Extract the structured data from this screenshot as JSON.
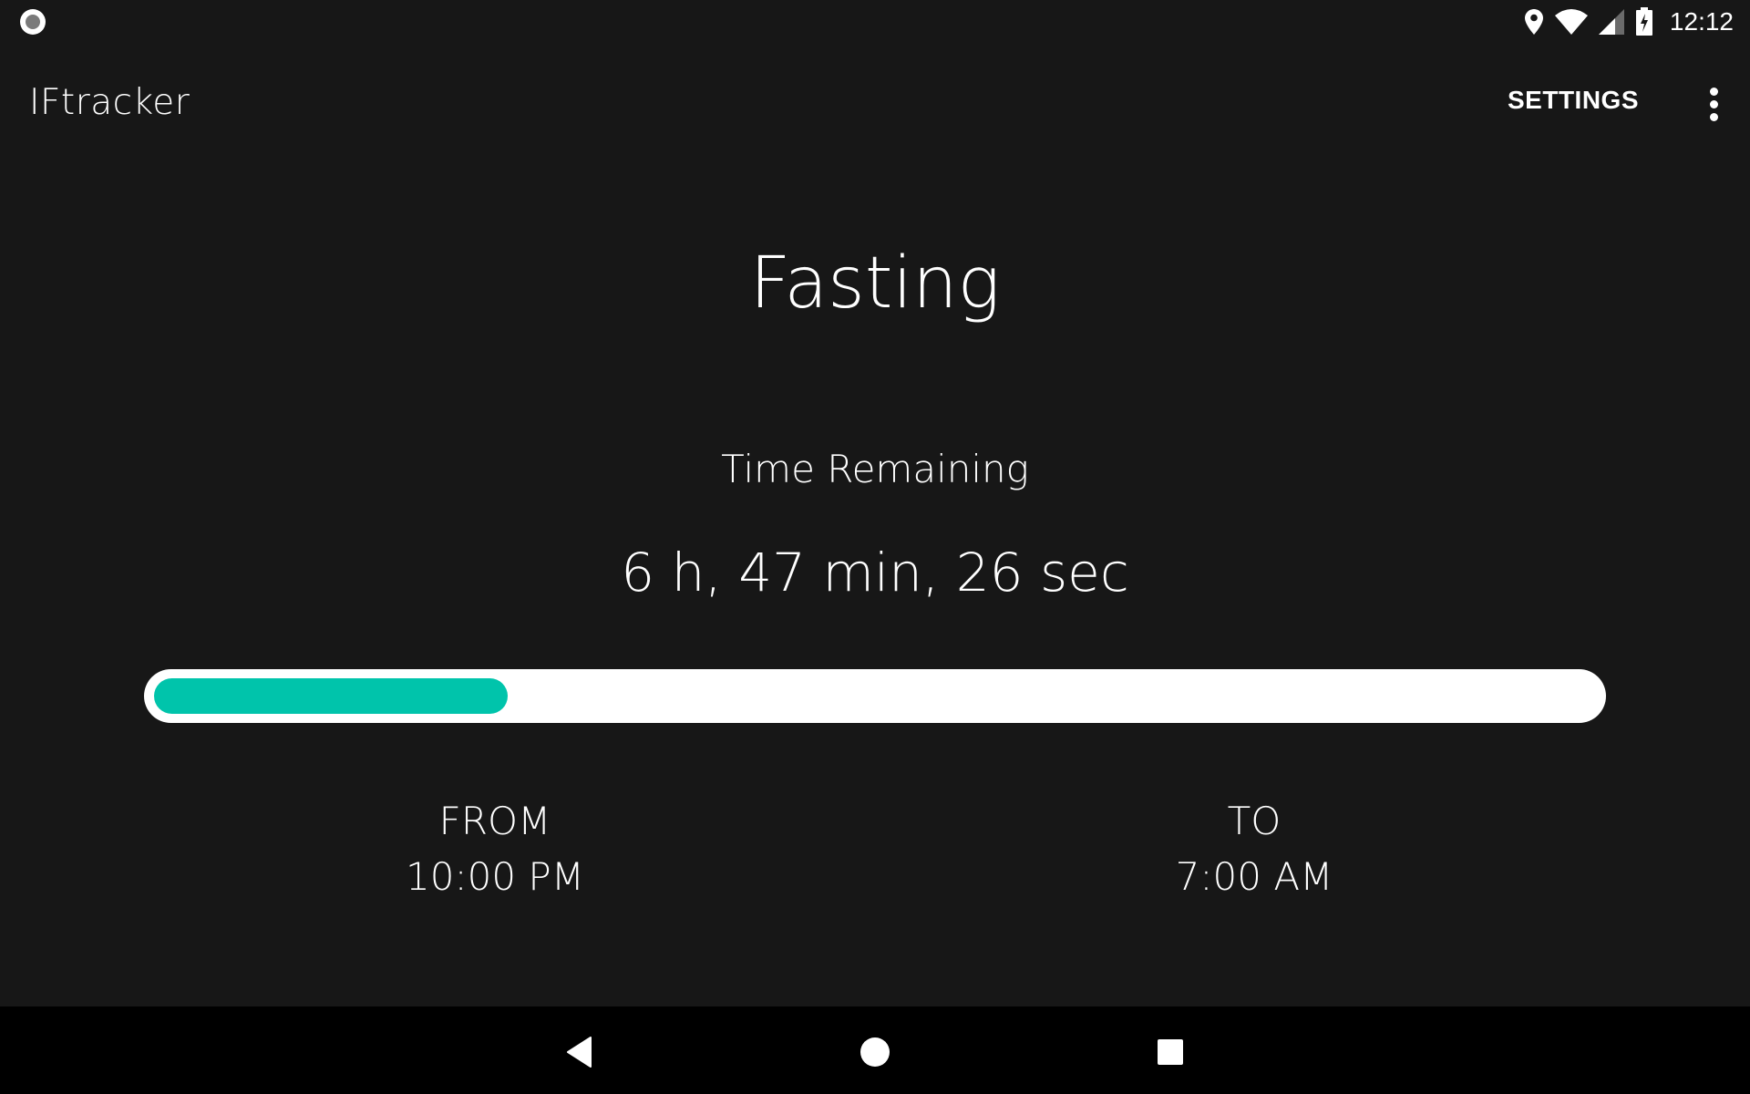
{
  "status_bar": {
    "time": "12:12",
    "icons": [
      "screen-record-icon",
      "location-icon",
      "wifi-icon",
      "signal-icon",
      "battery-charging-icon"
    ]
  },
  "app_bar": {
    "title": "IFtracker",
    "settings_label": "SETTINGS",
    "overflow_icon": "more-vert-icon"
  },
  "main": {
    "state": "Fasting",
    "remaining_label": "Time Remaining",
    "remaining_value": "6 h, 47 min, 26 sec",
    "progress": 0.245,
    "progress_color": "#00c4ab",
    "track_color": "#ffffff",
    "from": {
      "label": "FROM",
      "time": "10:00 PM"
    },
    "to": {
      "label": "TO",
      "time": "7:00 AM"
    }
  },
  "nav_bar": {
    "buttons": [
      "back-icon",
      "home-icon",
      "recents-icon"
    ]
  }
}
